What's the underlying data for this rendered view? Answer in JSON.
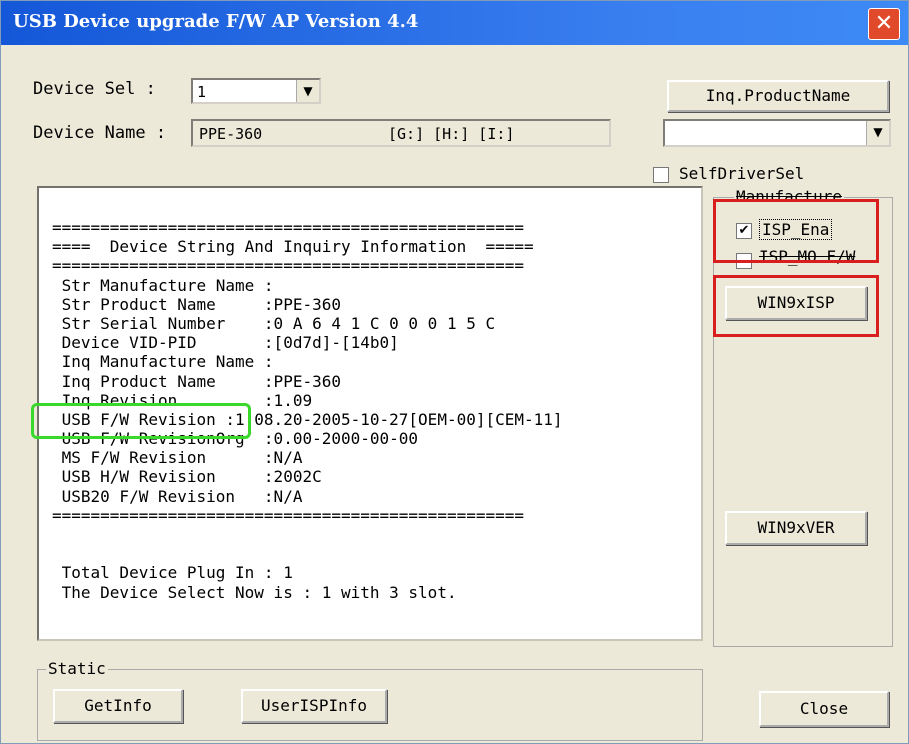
{
  "window": {
    "title": "USB Device upgrade F/W  AP  Version 4.4",
    "close_glyph": "✕"
  },
  "device_sel": {
    "label": "Device Sel  :",
    "value": "1"
  },
  "device_name": {
    "label": "Device Name :",
    "value": "PPE-360",
    "drives": "[G:] [H:] [I:]"
  },
  "inq_product_name_button": "Inq.ProductName",
  "product_combo_value": "",
  "self_driver_sel": {
    "label": "SelfDriverSel",
    "checked": false
  },
  "manufacture": {
    "group_label": "Manufacture",
    "isp_ena": {
      "label": "ISP_Ena",
      "checked": true
    },
    "isp_mo": {
      "label": "ISP_MO F/W",
      "checked": false
    },
    "win9x_isp_button": "WIN9xISP",
    "win9x_ver_button": "WIN9xVER"
  },
  "console_lines": [
    "=================================================",
    "====  Device String And Inquiry Information  =====",
    "=================================================",
    " Str Manufacture Name :",
    " Str Product Name     :PPE-360",
    " Str Serial Number    :0 A 6 4 1 C 0 0 0 1 5 C",
    " Device VID-PID       :[0d7d]-[14b0]",
    " Inq Manufacture Name :",
    " Inq Product Name     :PPE-360",
    " Inq Revision         :1.09",
    " USB F/W Revision :1.08.20-2005-10-27[OEM-00][CEM-11]",
    " USB F/W RevisionOrg  :0.00-2000-00-00",
    " MS F/W Revision      :N/A",
    " USB H/W Revision     :2002C",
    " USB20 F/W Revision   :N/A",
    "=================================================",
    "",
    "",
    " Total Device Plug In : 1",
    " The Device Select Now is : 1 with 3 slot."
  ],
  "static_group": {
    "label": "Static",
    "get_info_button": "GetInfo",
    "user_isp_info_button": "UserISPInfo"
  },
  "close_button": "Close",
  "colors": {
    "titlebar": "#1f5fe0",
    "window_bg": "#ece9d8",
    "highlight_red": "#d81e1e",
    "highlight_green": "#3ad82a"
  }
}
